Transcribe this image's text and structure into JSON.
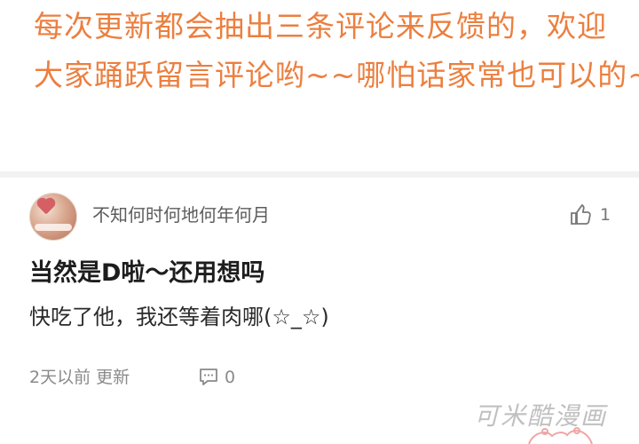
{
  "notice": {
    "lines": [
      "每次更新都会抽出三条评论来反馈的，欢迎",
      "大家踊跃留言评论哟~~哪怕话家常也可以的~"
    ],
    "color": "#ec7f3f"
  },
  "comment": {
    "username": "不知何时何地何年何月",
    "likes": "1",
    "headline": "当然是D啦～还用想吗",
    "body": "快吃了他，我还等着肉哪(☆_☆)",
    "meta": {
      "time": "2天以前",
      "status": "更新"
    },
    "reply_count": "0",
    "icons": {
      "like": "thumbs-up-icon",
      "reply": "comment-icon",
      "avatar": "avatar-image"
    }
  },
  "watermark": {
    "text": "可米酷漫画"
  },
  "colors": {
    "divider": "#f2f2f2",
    "meta_text": "#8a8a8a"
  }
}
